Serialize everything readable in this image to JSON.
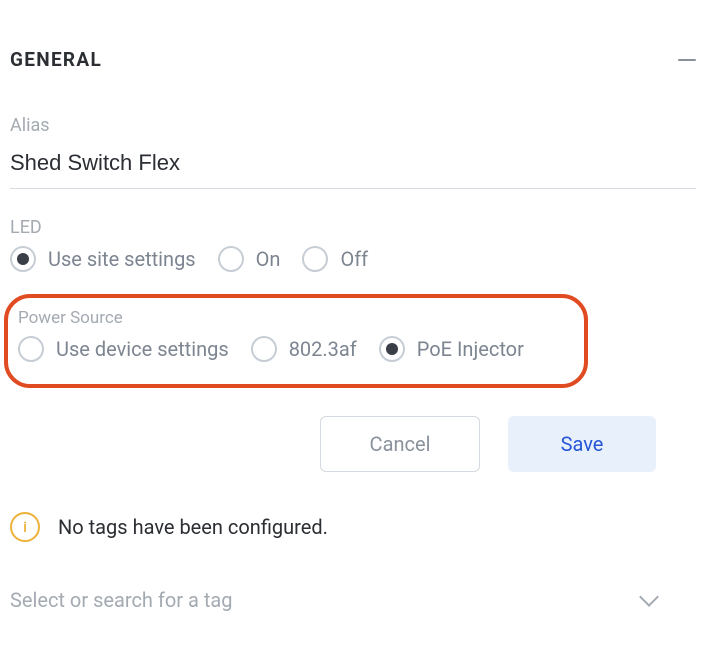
{
  "section": {
    "title": "GENERAL"
  },
  "alias": {
    "label": "Alias",
    "value": "Shed Switch Flex"
  },
  "led": {
    "label": "LED",
    "selected": "use_site_settings",
    "options": {
      "use_site_settings": "Use site settings",
      "on": "On",
      "off": "Off"
    }
  },
  "power_source": {
    "label": "Power Source",
    "selected": "poe_injector",
    "options": {
      "use_device_settings": "Use device settings",
      "af": "802.3af",
      "poe_injector": "PoE Injector"
    }
  },
  "buttons": {
    "cancel": "Cancel",
    "save": "Save"
  },
  "tags": {
    "notice": "No tags have been configured.",
    "placeholder": "Select or search for a tag"
  }
}
